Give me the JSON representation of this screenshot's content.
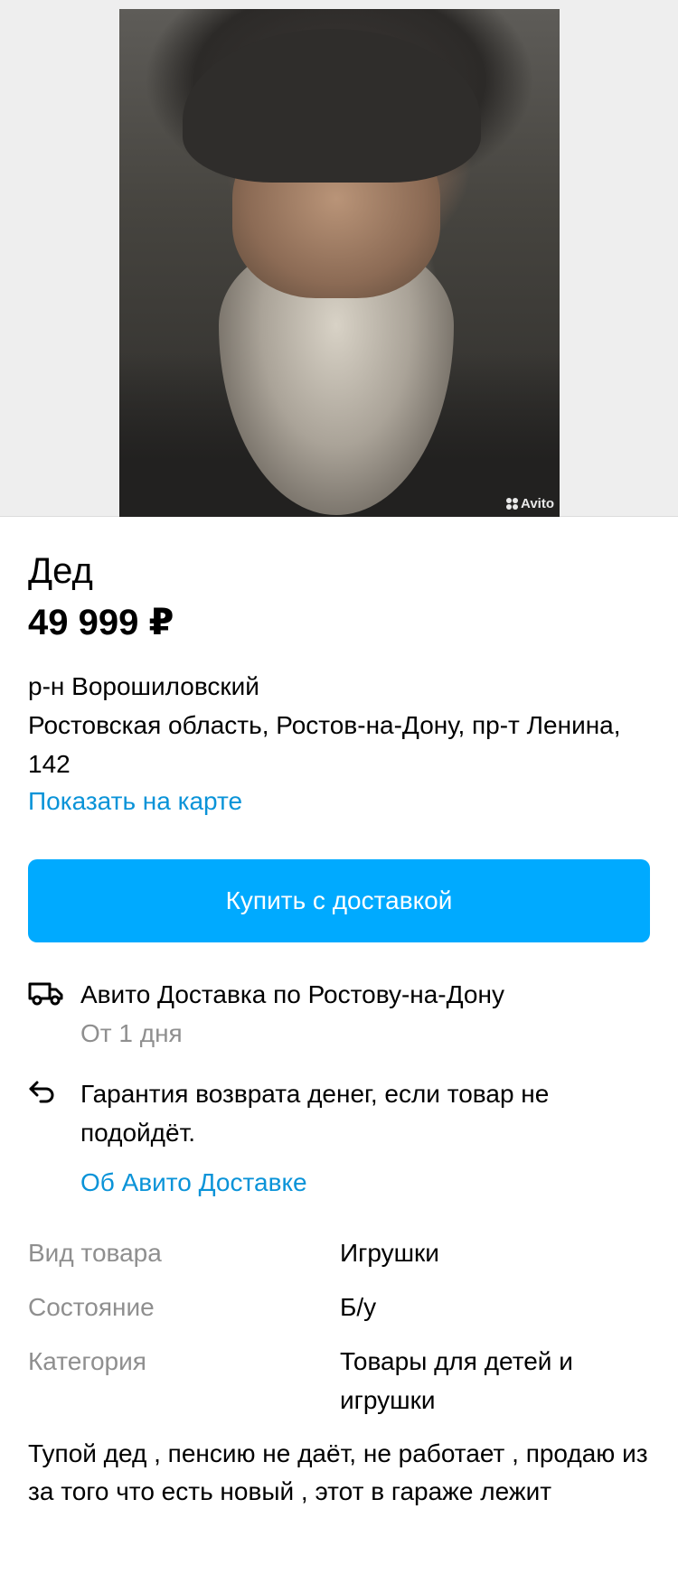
{
  "gallery": {
    "watermark": "Avito"
  },
  "item": {
    "title": "Дед",
    "price": "49 999 ₽",
    "district": "р-н Ворошиловский",
    "address": "Ростовская область, Ростов-на-Дону, пр-т Ленина, 142",
    "show_on_map": "Показать на карте"
  },
  "buy_button": "Купить с доставкой",
  "delivery": {
    "title": "Авито Доставка по Ростову-на-Дону",
    "subtitle": "От 1 дня"
  },
  "guarantee": {
    "text": "Гарантия возврата денег, если товар не подойдёт.",
    "link": "Об Авито Доставке"
  },
  "properties": [
    {
      "key": "Вид товара",
      "value": "Игрушки"
    },
    {
      "key": "Состояние",
      "value": "Б/у"
    },
    {
      "key": "Категория",
      "value": "Товары для детей и игрушки"
    }
  ],
  "description": "Тупой дед , пенсию не даёт,  не работает , продаю из за того что есть новый , этот в гараже лежит",
  "colors": {
    "accent": "#00aaff",
    "link": "#0a93d8",
    "muted": "#8f8f8f"
  }
}
